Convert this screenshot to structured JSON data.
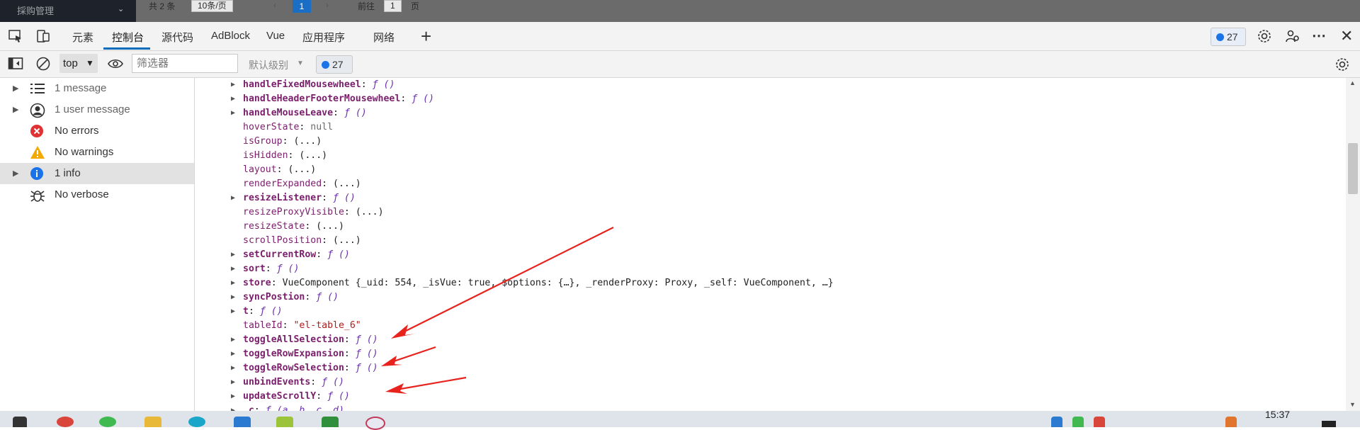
{
  "background_page": {
    "app_title": "採购管理",
    "total": "共 2 条",
    "page_size": "10条/页",
    "prev": "‹",
    "current_page": "1",
    "next": "›",
    "goto_label": "前往",
    "goto_value": "1",
    "page_suffix": "页"
  },
  "tabs": [
    "元素",
    "控制台",
    "源代码",
    "AdBlock",
    "Vue",
    "应用程序",
    "网络"
  ],
  "active_tab_index": 1,
  "issues_count": "27",
  "toolbar": {
    "context": "top",
    "filter_placeholder": "筛选器",
    "level": "默认级别",
    "issues_count": "27"
  },
  "sidebar": {
    "items": [
      {
        "label": "1 message",
        "icon": "list-icon",
        "expandable": true,
        "muted": true
      },
      {
        "label": "1 user message",
        "icon": "user-circle-icon",
        "expandable": true,
        "muted": true
      },
      {
        "label": "No errors",
        "icon": "error-icon",
        "expandable": false,
        "muted": false
      },
      {
        "label": "No warnings",
        "icon": "warning-icon",
        "expandable": false,
        "muted": false
      },
      {
        "label": "1 info",
        "icon": "info-icon",
        "expandable": true,
        "muted": false,
        "selected": true
      },
      {
        "label": "No verbose",
        "icon": "bug-icon",
        "expandable": false,
        "muted": false
      }
    ]
  },
  "console_lines": [
    {
      "expandable": true,
      "key": "handleFixedMousewheel",
      "value": "ƒ ()",
      "kind": "fn"
    },
    {
      "expandable": true,
      "key": "handleHeaderFooterMousewheel",
      "value": "ƒ ()",
      "kind": "fn"
    },
    {
      "expandable": true,
      "key": "handleMouseLeave",
      "value": "ƒ ()",
      "kind": "fn"
    },
    {
      "expandable": false,
      "key": "hoverState",
      "value": "null",
      "kind": "null"
    },
    {
      "expandable": false,
      "key": "isGroup",
      "value": "(...)",
      "kind": "plain"
    },
    {
      "expandable": false,
      "key": "isHidden",
      "value": "(...)",
      "kind": "plain"
    },
    {
      "expandable": false,
      "key": "layout",
      "value": "(...)",
      "kind": "plain"
    },
    {
      "expandable": false,
      "key": "renderExpanded",
      "value": "(...)",
      "kind": "plain"
    },
    {
      "expandable": true,
      "key": "resizeListener",
      "value": "ƒ ()",
      "kind": "fn"
    },
    {
      "expandable": false,
      "key": "resizeProxyVisible",
      "value": "(...)",
      "kind": "plain"
    },
    {
      "expandable": false,
      "key": "resizeState",
      "value": "(...)",
      "kind": "plain"
    },
    {
      "expandable": false,
      "key": "scrollPosition",
      "value": "(...)",
      "kind": "plain"
    },
    {
      "expandable": true,
      "key": "setCurrentRow",
      "value": "ƒ ()",
      "kind": "fn"
    },
    {
      "expandable": true,
      "key": "sort",
      "value": "ƒ ()",
      "kind": "fn"
    },
    {
      "expandable": true,
      "key": "store",
      "value": "VueComponent {_uid: 554, _isVue: true, $options: {…}, _renderProxy: Proxy, _self: VueComponent, …}",
      "kind": "obj"
    },
    {
      "expandable": true,
      "key": "syncPostion",
      "value": "ƒ ()",
      "kind": "fn"
    },
    {
      "expandable": true,
      "key": "t",
      "value": "ƒ ()",
      "kind": "fn"
    },
    {
      "expandable": false,
      "key": "tableId",
      "value": "\"el-table_6\"",
      "kind": "str"
    },
    {
      "expandable": true,
      "key": "toggleAllSelection",
      "value": "ƒ ()",
      "kind": "fn"
    },
    {
      "expandable": true,
      "key": "toggleRowExpansion",
      "value": "ƒ ()",
      "kind": "fn"
    },
    {
      "expandable": true,
      "key": "toggleRowSelection",
      "value": "ƒ ()",
      "kind": "fn"
    },
    {
      "expandable": true,
      "key": "unbindEvents",
      "value": "ƒ ()",
      "kind": "fn"
    },
    {
      "expandable": true,
      "key": "updateScrollY",
      "value": "ƒ ()",
      "kind": "fn"
    },
    {
      "expandable": true,
      "key": "_c",
      "value": "ƒ (a, b, c, d)",
      "kind": "fn"
    }
  ],
  "clock": "15:37",
  "colors": {
    "accent": "#0f6cbd",
    "annotation_arrow": "#e8231d",
    "error": "#e03232",
    "warning": "#f2a900",
    "info": "#1a73e8"
  }
}
